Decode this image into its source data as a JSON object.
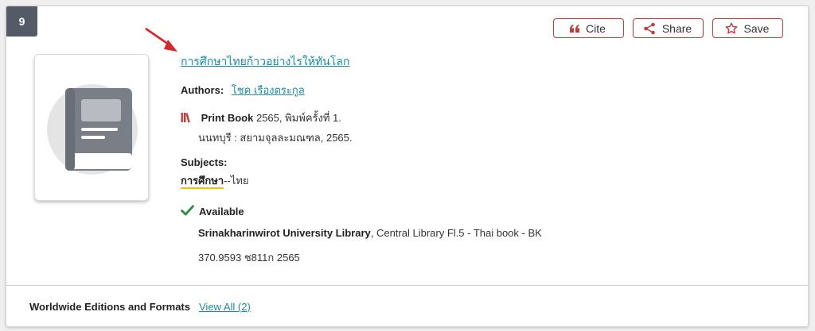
{
  "result": {
    "number": "9"
  },
  "actions": {
    "cite": "Cite",
    "share": "Share",
    "save": "Save"
  },
  "record": {
    "title": "การศึกษาไทยก้าวอย่างไรให้ทันโลก",
    "authors_label": "Authors:",
    "author": "โชค เรืองตระกูล",
    "format_name": "Print Book",
    "format_detail": " 2565, พิมพ์ครั้งที่ 1.",
    "publisher": "นนทบุรี : สยามจุลละมณฑล, 2565.",
    "subjects_label": "Subjects:",
    "subject_term": "การศึกษา",
    "subject_rest": "--ไทย",
    "availability": "Available",
    "library_name": "Srinakharinwirot University Library",
    "library_location": ", Central Library Fl.5 - Thai book - BK",
    "call_number": "370.9593 ช811ก 2565"
  },
  "footer": {
    "editions_label": "Worldwide Editions and Formats",
    "view_all": "View All (2)"
  },
  "icons": {
    "cite": "quote-icon",
    "share": "share-icon",
    "save": "star-icon",
    "format": "books-icon",
    "availability": "checkmark-icon",
    "cover": "book-icon",
    "annotation": "red-arrow-icon"
  },
  "colors": {
    "accent_red": "#c23b3b",
    "link": "#1a8aa6",
    "available_green": "#2e8b3e",
    "highlight": "#f2c200",
    "badge": "#555b66"
  }
}
